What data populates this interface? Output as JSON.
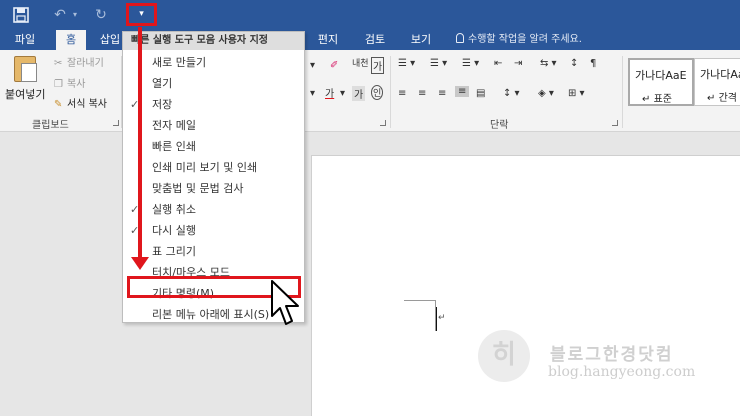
{
  "qat": {
    "save_icon": "save-icon",
    "undo_icon": "undo-icon",
    "redo_icon": "redo-icon",
    "customize_icon": "customize-dropdown-icon"
  },
  "tabs": [
    "파일",
    "홈",
    "삽입",
    "편지",
    "검토",
    "보기"
  ],
  "tell_me": "수행할 작업을 알려 주세요.",
  "clipboard": {
    "paste_label": "붙여넣기",
    "cut_label": "잘라내기",
    "copy_label": "복사",
    "format_painter_label": "서식 복사",
    "group_label": "클립보드"
  },
  "ribbon": {
    "paragraph_group_label": "단락",
    "styles": [
      {
        "sample": "가나다AaE",
        "name": "표준"
      },
      {
        "sample": "가나다AaE",
        "name": "간격 없"
      }
    ]
  },
  "dropdown": {
    "header": "빠른 실행 도구 모음 사용자 지정",
    "items": [
      {
        "label": "새로 만들기",
        "checked": false
      },
      {
        "label": "열기",
        "checked": false
      },
      {
        "label": "저장",
        "checked": true
      },
      {
        "label": "전자 메일",
        "checked": false
      },
      {
        "label": "빠른 인쇄",
        "checked": false
      },
      {
        "label": "인쇄 미리 보기 및 인쇄",
        "checked": false
      },
      {
        "label": "맞춤법 및 문법 검사",
        "checked": false
      },
      {
        "label": "실행 취소",
        "checked": true
      },
      {
        "label": "다시 실행",
        "checked": true
      },
      {
        "label": "표 그리기",
        "checked": false
      },
      {
        "label": "터치/마우스 모드",
        "checked": false
      },
      {
        "label": "기타 명령(M)...",
        "checked": false
      },
      {
        "label": "리본 메뉴 아래에 표시(S)",
        "checked": false
      }
    ]
  },
  "watermark": {
    "title": "블로그한경닷컴",
    "url": "blog.hangyeong.com"
  },
  "colors": {
    "accent": "#2b579a",
    "highlight": "#e0161c"
  }
}
